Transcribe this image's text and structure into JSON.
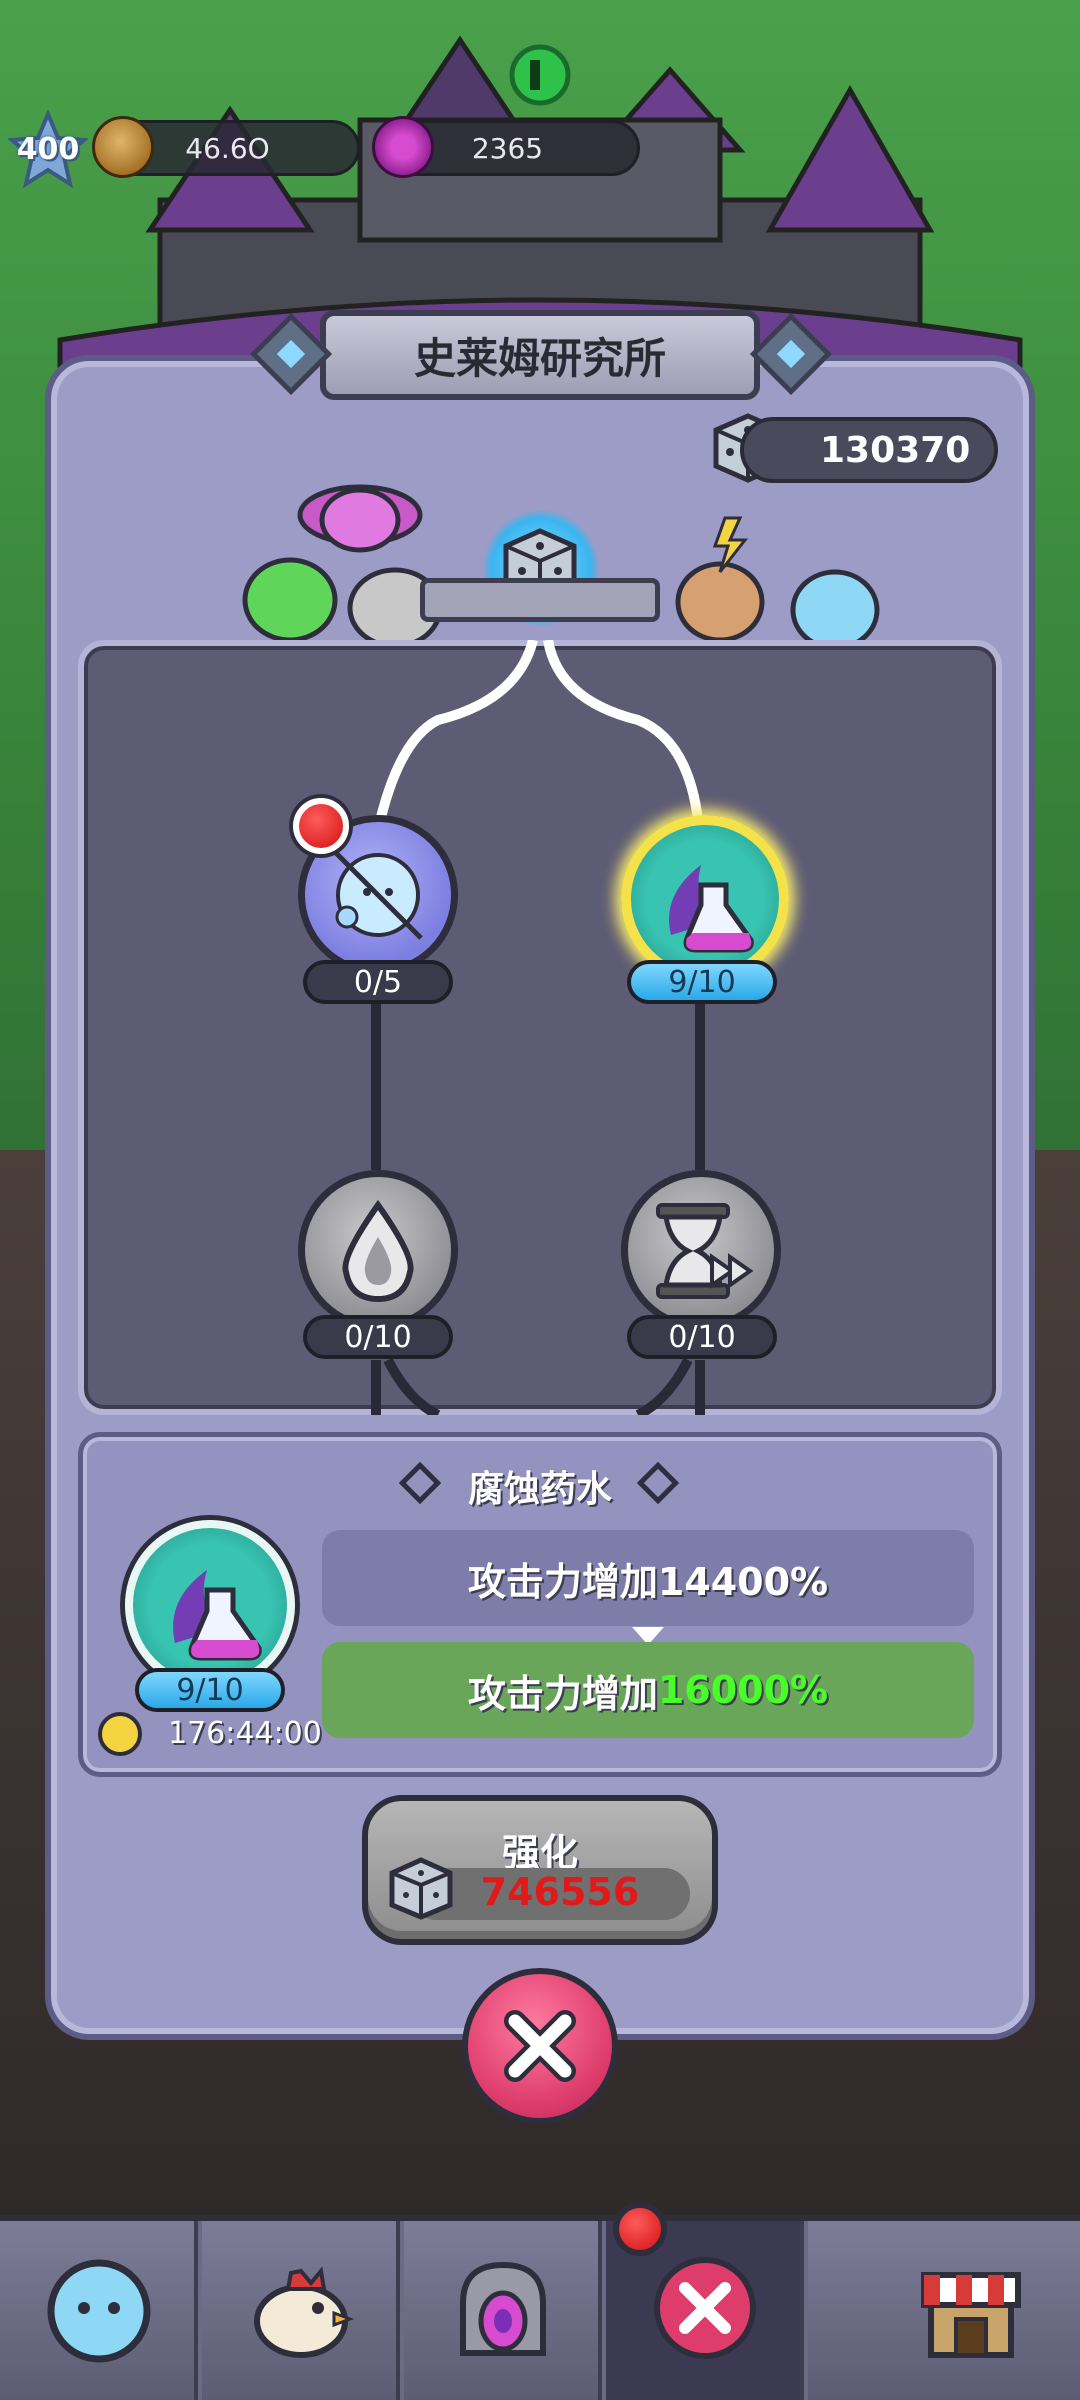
{
  "hud": {
    "level": "400",
    "coins": "46.6O",
    "gems": "2365"
  },
  "panel": {
    "title": "史莱姆研究所",
    "dice_count": "130370"
  },
  "tree": {
    "nodes": [
      {
        "name": "bubble-slime",
        "progress": "0/5",
        "has_alert": true
      },
      {
        "name": "corrosion-potion",
        "progress": "9/10",
        "selected": true
      },
      {
        "name": "water-drop",
        "progress": "0/10",
        "locked": true
      },
      {
        "name": "hourglass-speed",
        "progress": "0/10",
        "locked": true
      }
    ]
  },
  "detail": {
    "title": "腐蚀药水",
    "level": "9/10",
    "timer": "176:44:00",
    "current_stat": "攻击力增加14400%",
    "next_stat_prefix": "攻击力增加",
    "next_stat_value": "16000%"
  },
  "upgrade": {
    "label": "强化",
    "cost": "746556"
  },
  "colors": {
    "panel": "#9d9cc6",
    "tree_bg": "#5e5c75",
    "progress_active": "#2aa8e8",
    "selected_ring": "#f3e24a",
    "next_stat_bg": "#6aa65a",
    "next_stat_value": "#48ff28",
    "cost_text": "#e21919",
    "close_button": "#de3d6c"
  },
  "nav": {
    "tabs": [
      "slime-icon",
      "chicken-icon",
      "portal-icon",
      "lab-close-icon",
      "shop-icon"
    ],
    "active_tab": 3
  }
}
